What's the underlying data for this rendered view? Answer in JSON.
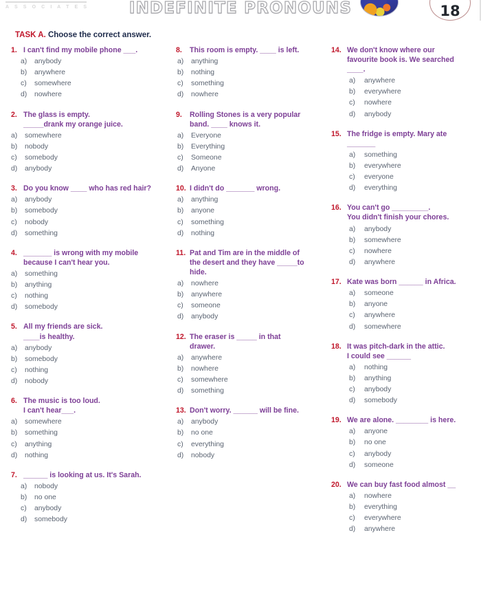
{
  "header": {
    "brand": "A S S O C I A T E S",
    "title": "INDEFINITE PRONOUNS",
    "page_number": "18",
    "globe_icon": "globe-icon",
    "accent_red": "#c0172b",
    "stem_purple": "#7d3f96",
    "option_gray": "#5b6472",
    "instruction_navy": "#1d2a4a"
  },
  "task": {
    "label": "TASK A.",
    "instruction": "Choose the correct answer."
  },
  "columns": [
    {
      "id": "column-1",
      "questions": [
        {
          "number": "1.",
          "stem": "I can't find my mobile phone ___.",
          "stem_line2": "",
          "opt_style": "indent",
          "options": [
            {
              "letter": "a)",
              "text": "anybody"
            },
            {
              "letter": "b)",
              "text": "anywhere"
            },
            {
              "letter": "c)",
              "text": "somewhere"
            },
            {
              "letter": "d)",
              "text": "nowhere"
            }
          ]
        },
        {
          "number": "2.",
          "stem": "The glass is empty.",
          "stem_line2": "_____drank my orange juice.",
          "opt_style": "flush",
          "options": [
            {
              "letter": "a)",
              "text": "somewhere"
            },
            {
              "letter": "b)",
              "text": "nobody"
            },
            {
              "letter": "c)",
              "text": "somebody"
            },
            {
              "letter": "d)",
              "text": "anybody"
            }
          ]
        },
        {
          "number": "3.",
          "stem": "Do you know ____ who has red hair?",
          "stem_line2": "",
          "opt_style": "flush",
          "options": [
            {
              "letter": "a)",
              "text": "anybody"
            },
            {
              "letter": "b)",
              "text": "somebody"
            },
            {
              "letter": "c)",
              "text": "nobody"
            },
            {
              "letter": "d)",
              "text": "something"
            }
          ]
        },
        {
          "number": "4.",
          "stem": "_______ is wrong with my mobile",
          "stem_line2": "because I can't hear you.",
          "opt_style": "flush",
          "options": [
            {
              "letter": "a)",
              "text": "something"
            },
            {
              "letter": "b)",
              "text": "anything"
            },
            {
              "letter": "c)",
              "text": "nothing"
            },
            {
              "letter": "d)",
              "text": "somebody"
            }
          ]
        },
        {
          "number": "5.",
          "stem": "All my friends are sick.",
          "stem_line2": "____is healthy.",
          "opt_style": "flush",
          "options": [
            {
              "letter": "a)",
              "text": "anybody"
            },
            {
              "letter": "b)",
              "text": "somebody"
            },
            {
              "letter": "c)",
              "text": "nothing"
            },
            {
              "letter": "d)",
              "text": "nobody"
            }
          ]
        },
        {
          "number": "6.",
          "stem": "The music is too loud.",
          "stem_line2": "I can't hear___.",
          "opt_style": "flush",
          "options": [
            {
              "letter": "a)",
              "text": "somewhere"
            },
            {
              "letter": "b)",
              "text": "something"
            },
            {
              "letter": "c)",
              "text": "anything"
            },
            {
              "letter": "d)",
              "text": "nothing"
            }
          ]
        },
        {
          "number": "7.",
          "stem": "______ is looking at us. It's Sarah.",
          "stem_line2": "",
          "opt_style": "indent",
          "options": [
            {
              "letter": "a)",
              "text": "nobody"
            },
            {
              "letter": "b)",
              "text": "no one"
            },
            {
              "letter": "c)",
              "text": "anybody"
            },
            {
              "letter": "d)",
              "text": "somebody"
            }
          ]
        }
      ]
    },
    {
      "id": "column-2",
      "questions": [
        {
          "number": "8.",
          "stem": "This room is empty. ____ is left.",
          "stem_line2": "",
          "opt_style": "flush",
          "options": [
            {
              "letter": "a)",
              "text": "anything"
            },
            {
              "letter": "b)",
              "text": "nothing"
            },
            {
              "letter": "c)",
              "text": "something"
            },
            {
              "letter": "d)",
              "text": "nowhere"
            }
          ]
        },
        {
          "number": "9.",
          "stem": "Rolling Stones is a very popular",
          "stem_line2": "band. ____ knows it.",
          "opt_style": "flush",
          "options": [
            {
              "letter": "a)",
              "text": "Everyone"
            },
            {
              "letter": "b)",
              "text": "Everything"
            },
            {
              "letter": "c)",
              "text": "Someone"
            },
            {
              "letter": "d)",
              "text": "Anyone"
            }
          ]
        },
        {
          "number": "10.",
          "stem": "I didn't do _______ wrong.",
          "stem_line2": "",
          "opt_style": "flush",
          "options": [
            {
              "letter": "a)",
              "text": "anything"
            },
            {
              "letter": "b)",
              "text": "anyone"
            },
            {
              "letter": "c)",
              "text": "something"
            },
            {
              "letter": "d)",
              "text": "nothing"
            }
          ]
        },
        {
          "number": "11.",
          "stem": "Pat and Tim are in the middle of",
          "stem_line2": "the desert and they have _____to",
          "stem_line3": "hide.",
          "opt_style": "flush",
          "options": [
            {
              "letter": "a)",
              "text": "nowhere"
            },
            {
              "letter": "b)",
              "text": "anywhere"
            },
            {
              "letter": "c)",
              "text": "someone"
            },
            {
              "letter": "d)",
              "text": "anybody"
            }
          ]
        },
        {
          "number": "12.",
          "stem": "The eraser is _____ in that",
          "stem_line2": "drawer.",
          "opt_style": "flush",
          "options": [
            {
              "letter": "a)",
              "text": "anywhere"
            },
            {
              "letter": "b)",
              "text": "nowhere"
            },
            {
              "letter": "c)",
              "text": "somewhere"
            },
            {
              "letter": "d)",
              "text": "something"
            }
          ]
        },
        {
          "number": "13.",
          "stem": "Don't worry. ______ will be fine.",
          "stem_line2": "",
          "opt_style": "flush",
          "options": [
            {
              "letter": "a)",
              "text": "anybody"
            },
            {
              "letter": "b)",
              "text": "no one"
            },
            {
              "letter": "c)",
              "text": "everything"
            },
            {
              "letter": "d)",
              "text": "nobody"
            }
          ]
        }
      ]
    },
    {
      "id": "column-3",
      "questions": [
        {
          "number": "14.",
          "stem": "We don't know where our",
          "stem_line2": "favourite book is. We searched",
          "stem_line3": "____.",
          "opt_style": "indent",
          "options": [
            {
              "letter": "a)",
              "text": "anywhere"
            },
            {
              "letter": "b)",
              "text": "everywhere"
            },
            {
              "letter": "c)",
              "text": "nowhere"
            },
            {
              "letter": "d)",
              "text": "anybody"
            }
          ]
        },
        {
          "number": "15.",
          "stem": "The fridge is empty. Mary ate",
          "stem_line2": "_______",
          "opt_style": "indent",
          "options": [
            {
              "letter": "a)",
              "text": "something"
            },
            {
              "letter": "b)",
              "text": "everywhere"
            },
            {
              "letter": "c)",
              "text": "everyone"
            },
            {
              "letter": "d)",
              "text": "everything"
            }
          ]
        },
        {
          "number": "16.",
          "stem": "You can't go _________.",
          "stem_line2": "You didn't finish your chores.",
          "opt_style": "indent",
          "options": [
            {
              "letter": "a)",
              "text": "anybody"
            },
            {
              "letter": "b)",
              "text": "somewhere"
            },
            {
              "letter": "c)",
              "text": "nowhere"
            },
            {
              "letter": "d)",
              "text": "anywhere"
            }
          ]
        },
        {
          "number": "17.",
          "stem": "Kate was born ______ in Africa.",
          "stem_line2": "",
          "opt_style": "indent",
          "options": [
            {
              "letter": "a)",
              "text": "someone"
            },
            {
              "letter": "b)",
              "text": "anyone"
            },
            {
              "letter": "c)",
              "text": "anywhere"
            },
            {
              "letter": "d)",
              "text": "somewhere"
            }
          ]
        },
        {
          "number": "18.",
          "stem": "It was pitch-dark in the attic.",
          "stem_line2": "I could see ______",
          "opt_style": "indent",
          "options": [
            {
              "letter": "a)",
              "text": "nothing"
            },
            {
              "letter": "b)",
              "text": "anything"
            },
            {
              "letter": "c)",
              "text": "anybody"
            },
            {
              "letter": "d)",
              "text": "somebody"
            }
          ]
        },
        {
          "number": "19.",
          "stem": "We are alone. ________ is here.",
          "stem_line2": "",
          "opt_style": "indent",
          "options": [
            {
              "letter": "a)",
              "text": "anyone"
            },
            {
              "letter": "b)",
              "text": "no one"
            },
            {
              "letter": "c)",
              "text": "anybody"
            },
            {
              "letter": "d)",
              "text": "someone"
            }
          ]
        },
        {
          "number": "20.",
          "stem": "We can buy fast food almost __",
          "stem_line2": "",
          "opt_style": "indent",
          "options": [
            {
              "letter": "a)",
              "text": "nowhere"
            },
            {
              "letter": "b)",
              "text": "everything"
            },
            {
              "letter": "c)",
              "text": "everywhere"
            },
            {
              "letter": "d)",
              "text": "anywhere"
            }
          ]
        }
      ]
    }
  ]
}
